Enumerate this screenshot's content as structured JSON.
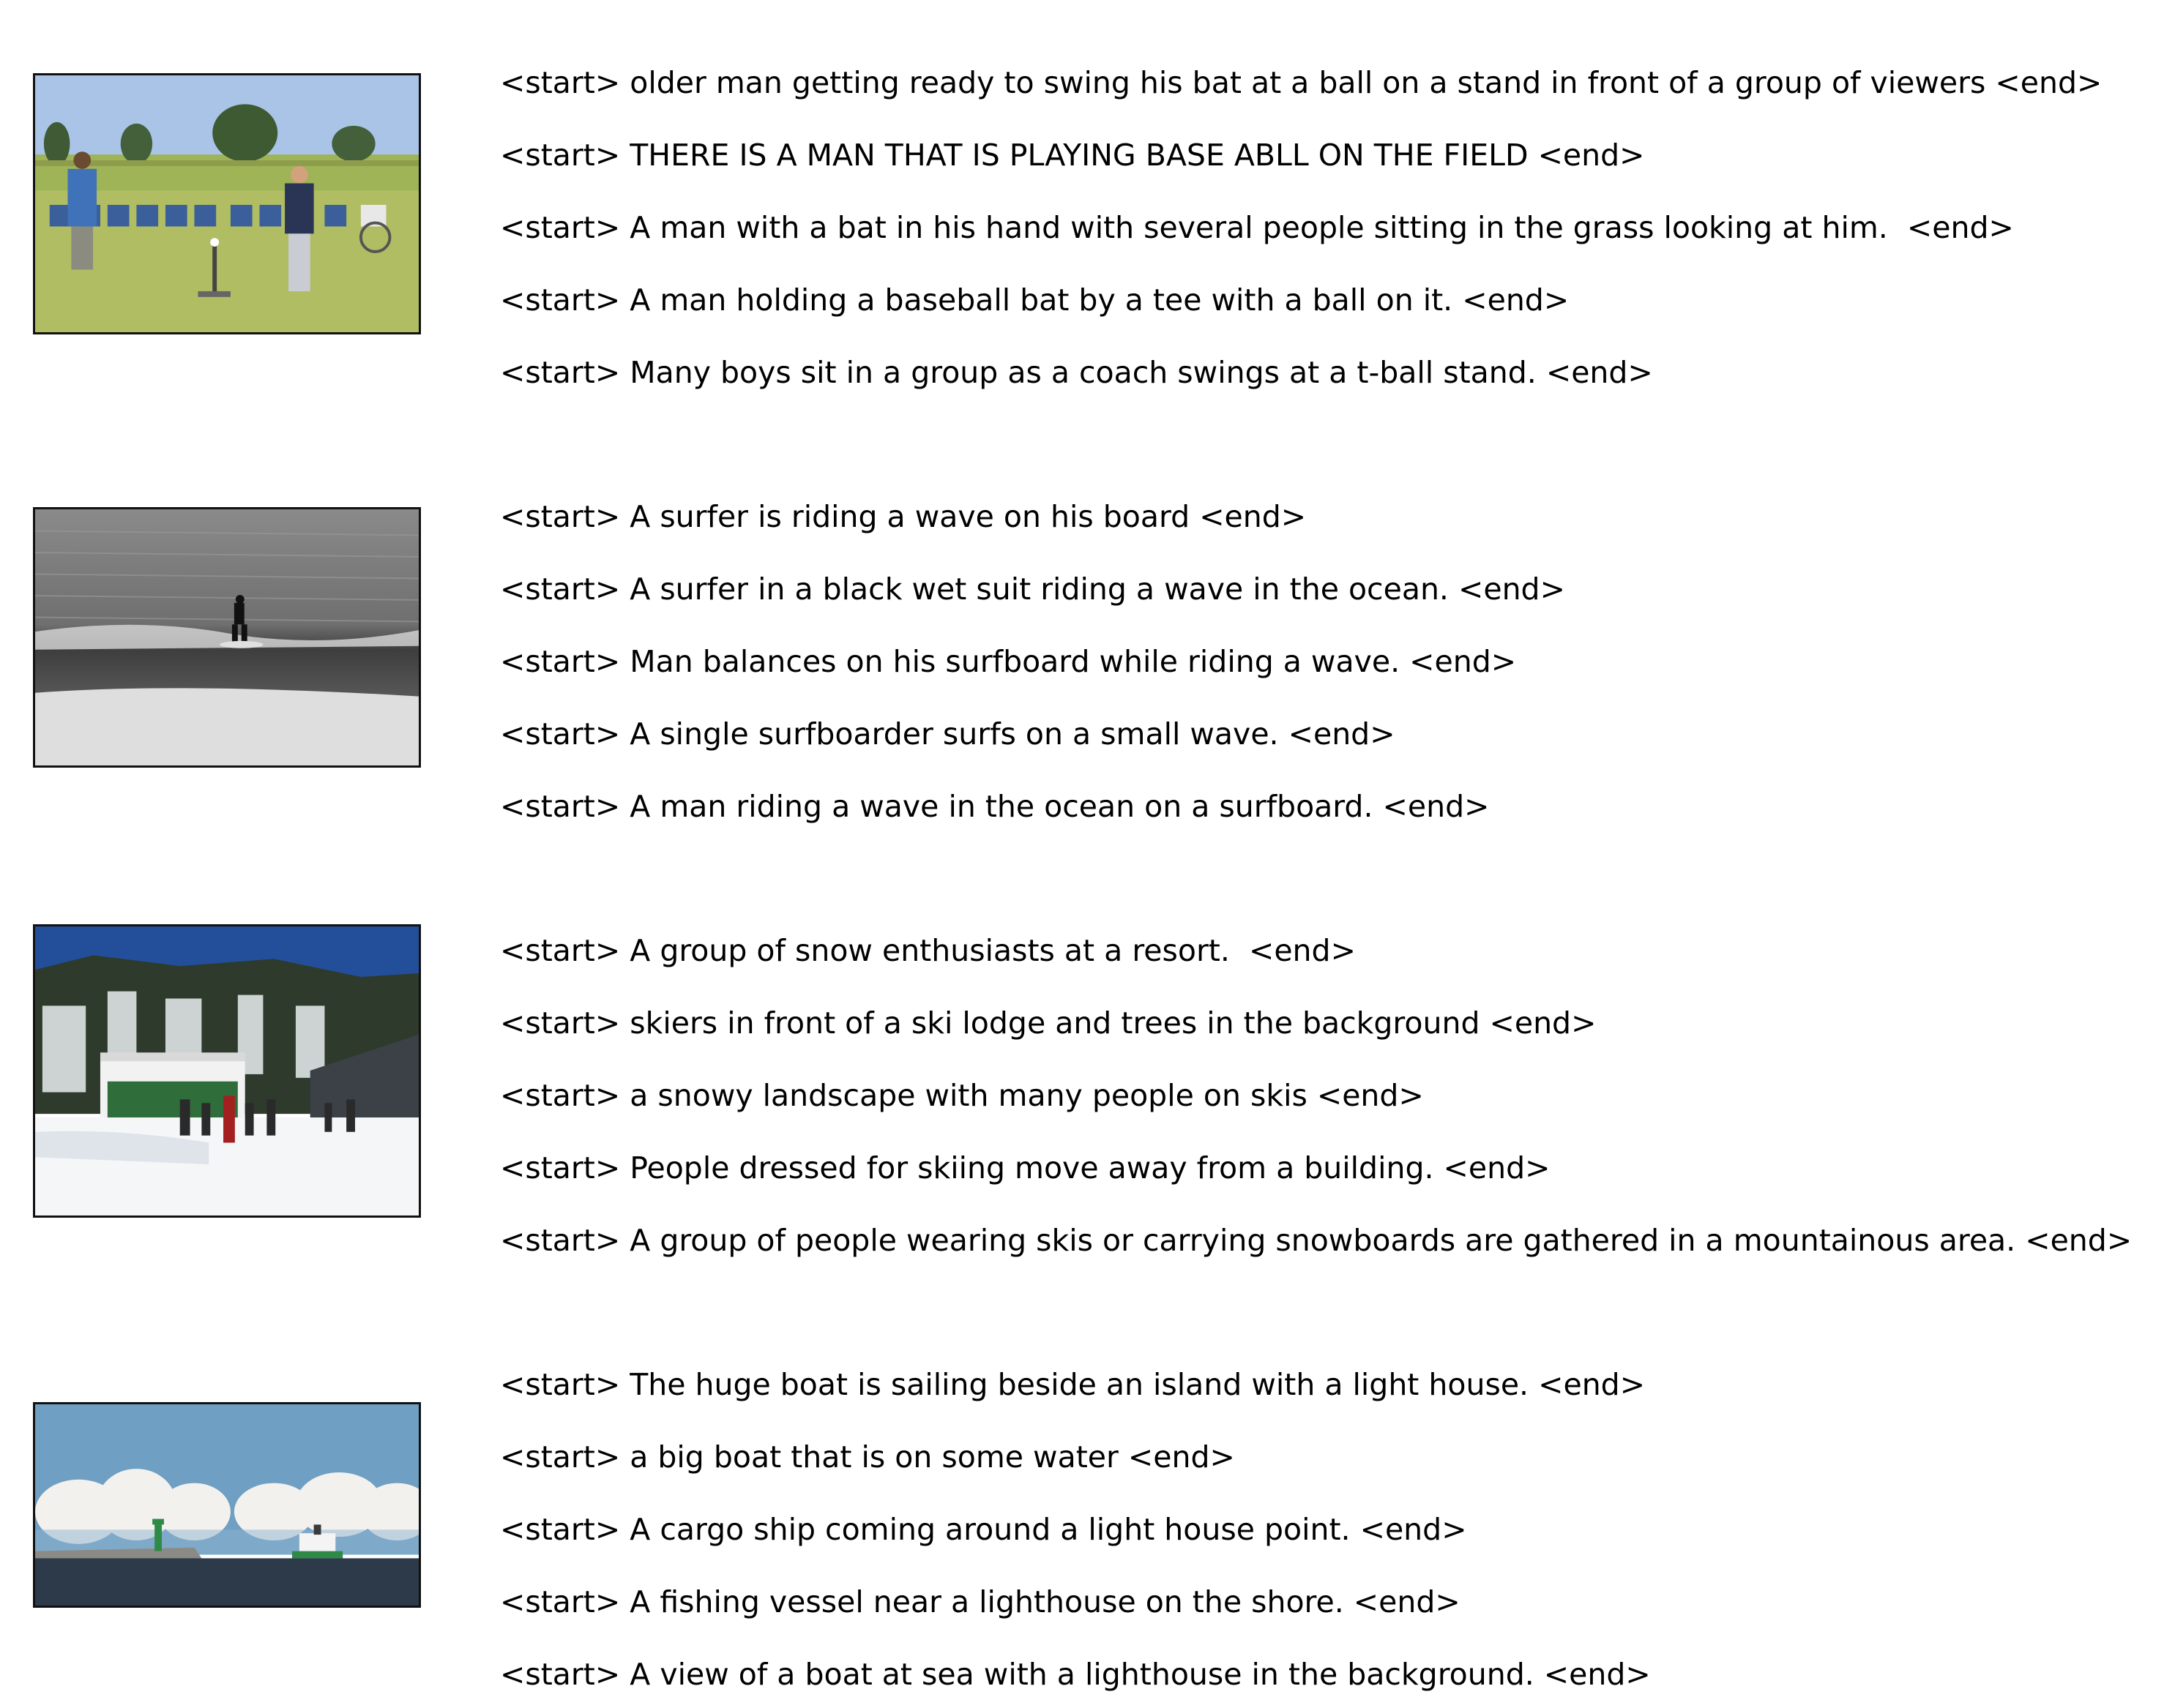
{
  "groups": [
    {
      "image_label": "baseball-tee-photo",
      "captions": [
        "<start> older man getting ready to swing his bat at a ball on a stand in front of a group of viewers <end>",
        "<start> THERE IS A MAN THAT IS PLAYING BASE ABLL ON THE FIELD <end>",
        "<start> A man with a bat in his hand with several people sitting in the grass looking at him.  <end>",
        "<start> A man holding a baseball bat by a tee with a ball on it. <end>",
        "<start> Many boys sit in a group as a coach swings at a t-ball stand. <end>"
      ]
    },
    {
      "image_label": "surfer-photo",
      "captions": [
        "<start> A surfer is riding a wave on his board <end>",
        "<start> A surfer in a black wet suit riding a wave in the ocean. <end>",
        "<start> Man balances on his surfboard while riding a wave. <end>",
        "<start> A single surfboarder surfs on a small wave. <end>",
        "<start> A man riding a wave in the ocean on a surfboard. <end>"
      ]
    },
    {
      "image_label": "ski-resort-photo",
      "captions": [
        "<start> A group of snow enthusiasts at a resort.  <end>",
        "<start> skiers in front of a ski lodge and trees in the background <end>",
        "<start> a snowy landscape with many people on skis <end>",
        "<start> People dressed for skiing move away from a building. <end>",
        "<start> A group of people wearing skis or carrying snowboards are gathered in a mountainous area. <end>"
      ]
    },
    {
      "image_label": "boat-lighthouse-photo",
      "captions": [
        "<start> The huge boat is sailing beside an island with a light house. <end>",
        "<start> a big boat that is on some water <end>",
        "<start> A cargo ship coming around a light house point. <end>",
        "<start> A fishing vessel near a lighthouse on the shore. <end>",
        "<start> A view of a boat at sea with a lighthouse in the background. <end>"
      ]
    }
  ]
}
